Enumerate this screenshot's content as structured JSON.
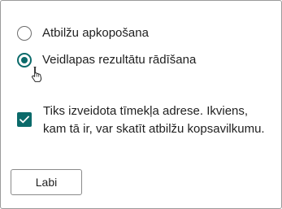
{
  "options": {
    "radio_summary": {
      "label": "Atbilžu apkopošana",
      "selected": false
    },
    "radio_form_results": {
      "label": "Veidlapas rezultātu rādīšana",
      "selected": true
    }
  },
  "share_link": {
    "checked": true,
    "label": "Tiks izveidota tīmekļa adrese. Ikviens, kam tā ir, var skatīt atbilžu kopsavilkumu."
  },
  "buttons": {
    "ok_label": "Labi"
  },
  "colors": {
    "accent": "#0b6a6a",
    "border": "#9a9a9a"
  },
  "icons": {
    "cursor": "hand-pointer-icon",
    "check": "checkmark-icon"
  }
}
